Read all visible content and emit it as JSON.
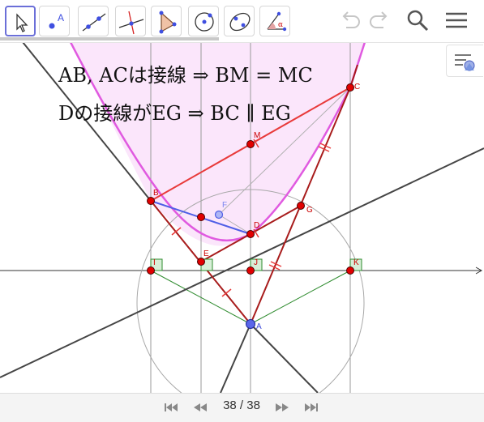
{
  "toolbar": {
    "tools": [
      {
        "name": "move-tool",
        "icon": "pointer-arrow-icon",
        "active": true
      },
      {
        "name": "point-tool",
        "icon": "point-a-icon",
        "label": "A"
      },
      {
        "name": "line-tool",
        "icon": "line-through-points-icon"
      },
      {
        "name": "perpendicular-line-tool",
        "icon": "perpendicular-line-icon"
      },
      {
        "name": "polygon-tool",
        "icon": "triangle-polygon-icon"
      },
      {
        "name": "circle-center-point-tool",
        "icon": "circle-with-center-icon"
      },
      {
        "name": "conic-through-points-tool",
        "icon": "ellipse-through-points-icon"
      },
      {
        "name": "angle-tool",
        "icon": "angle-icon",
        "label": "α"
      }
    ],
    "right": {
      "undo": "undo-icon",
      "redo": "redo-icon",
      "search": "search-icon",
      "menu": "hamburger-menu-icon"
    }
  },
  "style_bar": {
    "icon": "style-bar-toggle-icon"
  },
  "formulas": {
    "line1": "AB, ACは接線 ⇒ BM = MC",
    "line2": "Dの接線がEG ⇒ BC ∥ EG"
  },
  "points": {
    "A": "A",
    "B": "B",
    "C": "C",
    "D": "D",
    "E": "E",
    "F": "F",
    "G": "G",
    "I": "I",
    "J": "J",
    "K": "K",
    "M": "M"
  },
  "colors": {
    "parabola": "#e05ae0",
    "parabola_fill": "#fbe6fb",
    "chord": "#e83a3a",
    "tangent": "#a81c1c",
    "line": "#454545",
    "free_point": "#4f5ee6",
    "point": "#e10000",
    "green": "#2e8b2e"
  },
  "navigation": {
    "step_current": "38",
    "step_total": "38",
    "step_text": "38 / 38",
    "first": "skip-back-icon",
    "prev": "rewind-icon",
    "next": "fast-forward-icon",
    "last": "skip-forward-icon"
  }
}
